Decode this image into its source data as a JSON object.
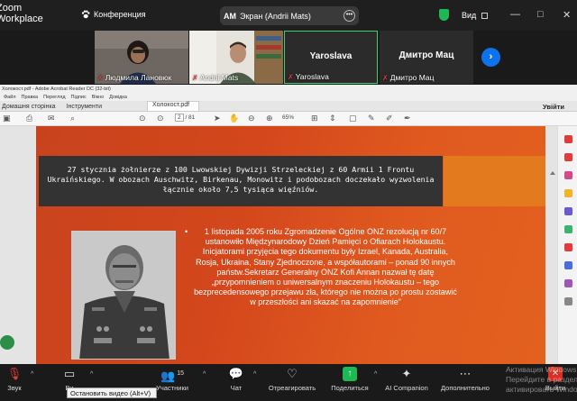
{
  "zoom": {
    "app_name_line1": "Zoom",
    "app_name_line2": "Workplace",
    "meeting_label": "Конференция",
    "share_initials": "AM",
    "share_label": "Экран (Andrii Mats)",
    "view_label": "Вид",
    "colors": {
      "accent_green": "#1db954",
      "accent_blue": "#0e72ed",
      "mic_off": "#e0403a"
    }
  },
  "participants": [
    {
      "name": "Людмила Лановюк",
      "display": "video"
    },
    {
      "name": "Andrii Mats",
      "display": "video"
    },
    {
      "name": "Yaroslava",
      "big_name": "Yaroslava",
      "display": "name",
      "active": true
    },
    {
      "name": "Дмитро Мац",
      "big_name": "Дмитро Мац",
      "display": "name"
    }
  ],
  "acrobat": {
    "title": "Холокост.pdf - Adobe Acrobat Reader DC (32-bit)",
    "menu": [
      "Файл",
      "Правка",
      "Перегляд",
      "Підпис",
      "Вікно",
      "Довідка"
    ],
    "tabs": {
      "home": "Домашня сторінка",
      "tools": "Інструменти",
      "document": "Холокост.pdf"
    },
    "sign_in": "Увійти",
    "page_current": "2",
    "page_total": "/ 81",
    "zoom": "65%"
  },
  "slide": {
    "box_text": "27 stycznia żołnierze z 100 Lwowskiej Dywizji Strzeleckiej z 60 Armii 1 Frontu Ukraińskiego. W obozach Auschwitz, Birkenau, Monowitz i podobozach doczekało wyzwolenia łącznie około 7,5 tysiąca więźniów.",
    "bullet": "•",
    "body_text": "1 listopada 2005 roku Zgromadzenie Ogólne ONZ rezolucją nr 60/7 ustanowiło Międzynarodowy Dzień Pamięci o Ofiarach Holokaustu. Inicjatorami przyjęcia tego dokumentu były Izrael, Kanada, Australia, Rosja, Ukraina, Stany Zjednoczone, a współautorami – ponad 90 innych państw.Sekretarz Generalny ONZ Kofi Annan nazwał tę datę „przypomnieniem o uniwersalnym znaczeniu Holokaustu – tego bezprecedensowego przejawu zła, którego nie można po prostu zostawić w przeszłości ani skazać na zapomnienie”"
  },
  "controls": {
    "audio": "Звук",
    "video": "Ви",
    "participants": "Участники",
    "participants_count": "15",
    "chat": "Чат",
    "react": "Отреагировать",
    "share": "Поделиться",
    "ai": "AI Companion",
    "more": "Дополнительно",
    "exit": "Выйти",
    "tooltip": "Остановить видео (Alt+V)"
  },
  "watermark": {
    "line1": "Активация Windows",
    "line2": "Перейдите в раздел",
    "line3": "активировать Windows"
  }
}
